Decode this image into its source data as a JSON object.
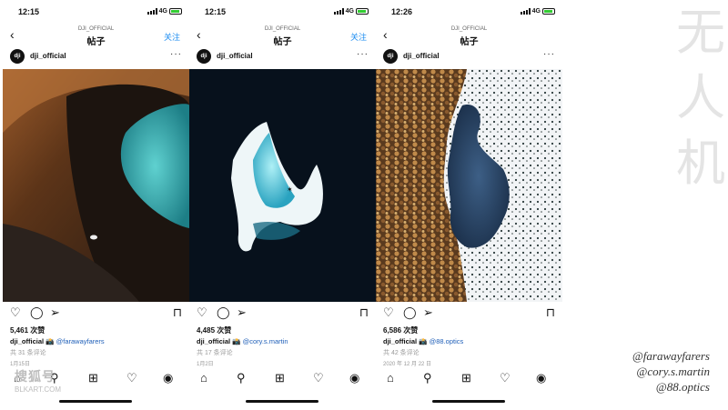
{
  "watermark_chars": [
    "无",
    "人",
    "机"
  ],
  "credits": [
    "@farawayfarers",
    "@cory.s.martin",
    "@88.optics"
  ],
  "bottom_watermark": {
    "main": "搜狐号",
    "sub": "BLKART.COM"
  },
  "phones": [
    {
      "time": "12:15",
      "network": "4G",
      "nav_sub": "DJI_OFFICIAL",
      "nav_title": "帖子",
      "follow": "关注",
      "account": "dji_official",
      "avatar_text": "dji",
      "likes": "5,461 次赞",
      "caption_user": "dji_official",
      "caption_icon": "📸",
      "mention": "@farawayfarers",
      "comments": "共 31 条评论",
      "date": "1月15日",
      "photo": "desert-lagoon"
    },
    {
      "time": "12:15",
      "network": "4G",
      "nav_sub": "DJI_OFFICIAL",
      "nav_title": "帖子",
      "follow": "关注",
      "account": "dji_official",
      "avatar_text": "dji",
      "likes": "4,485 次赞",
      "caption_user": "dji_official",
      "caption_icon": "📸",
      "mention": "@cory.s.martin",
      "comments": "共 17 条评论",
      "date": "1月2日",
      "photo": "iceberg-diver"
    },
    {
      "time": "12:26",
      "network": "4G",
      "nav_sub": "DJI_OFFICIAL",
      "nav_title": "帖子",
      "follow": "",
      "account": "dji_official",
      "avatar_text": "dji",
      "likes": "6,586 次赞",
      "caption_user": "dji_official",
      "caption_icon": "📸",
      "mention": "@88.optics",
      "comments": "共 42 条评论",
      "date": "2020 年 12 月 22 日",
      "photo": "forest-frozen-lake"
    }
  ],
  "icons": {
    "like": "heart-icon",
    "comment": "comment-icon",
    "share": "send-icon",
    "save": "bookmark-icon",
    "home": "home-icon",
    "search": "search-icon",
    "add": "add-post-icon",
    "activity": "heart-icon",
    "profile": "profile-icon"
  },
  "colors": {
    "follow": "#1f8ef1",
    "mention": "#1f5fb8",
    "lagoon": "#3fb6bb",
    "night_water": "#07111c"
  }
}
